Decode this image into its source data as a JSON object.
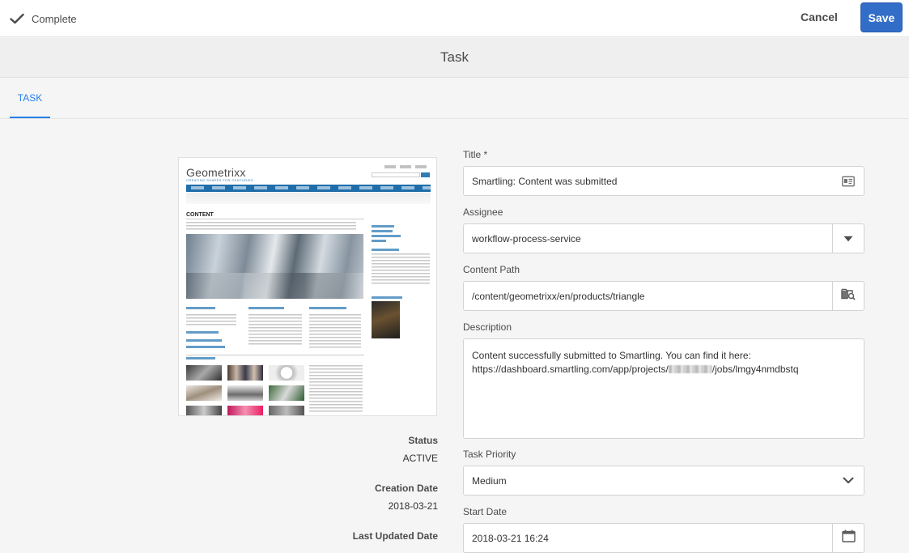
{
  "actionbar": {
    "complete_label": "Complete",
    "cancel_label": "Cancel",
    "save_label": "Save"
  },
  "page": {
    "title": "Task"
  },
  "tabs": [
    {
      "label": "TASK",
      "active": true
    }
  ],
  "thumbnail": {
    "logo": "Geometrixx",
    "logo_sub": "CREATING SHAPES FOR CENTURIES",
    "heading": "CONTENT"
  },
  "meta": {
    "status_label": "Status",
    "status_value": "ACTIVE",
    "creation_label": "Creation Date",
    "creation_value": "2018-03-21",
    "updated_label": "Last Updated Date"
  },
  "form": {
    "title_label": "Title *",
    "title_value": "Smartling: Content was submitted",
    "assignee_label": "Assignee",
    "assignee_value": "workflow-process-service",
    "content_path_label": "Content Path",
    "content_path_value": "/content/geometrixx/en/products/triangle",
    "description_label": "Description",
    "description_line1": "Content successfully submitted to Smartling. You can find it here:",
    "description_line2_prefix": "https://dashboard.smartling.com/app/projects/",
    "description_line2_suffix": "/jobs/lmgy4nmdbstq",
    "priority_label": "Task Priority",
    "priority_value": "Medium",
    "start_date_label": "Start Date",
    "start_date_value": "2018-03-21 16:24"
  },
  "icons": {
    "complete": "checkmark-icon",
    "title_field": "id-card-icon",
    "assignee": "caret-down-icon",
    "content_path": "folder-search-icon",
    "priority": "chevron-down-icon",
    "start_date": "calendar-icon"
  },
  "colors": {
    "primary": "#326ec8",
    "tab_active": "#2680eb"
  }
}
